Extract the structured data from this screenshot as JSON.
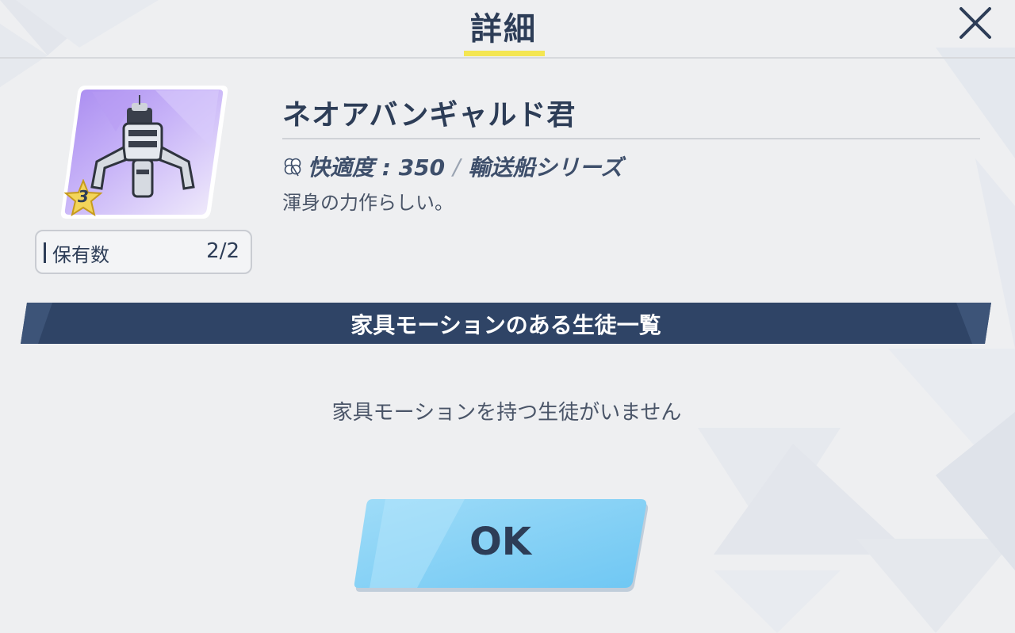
{
  "header": {
    "title": "詳細"
  },
  "item": {
    "name": "ネオアバンギャルド君",
    "rank": "3",
    "owned_label": "保有数",
    "owned_value": "2/2",
    "comfort": "快適度 : 350",
    "series": "輸送船シリーズ",
    "description": "渾身の力作らしい。"
  },
  "section": {
    "title": "家具モーションのある生徒一覧",
    "empty_message": "家具モーションを持つ生徒がいません"
  },
  "actions": {
    "ok_label": "OK"
  },
  "colors": {
    "accent_yellow": "#f4e652",
    "banner_navy": "#2f4466",
    "button_blue": "#86d4f7",
    "text_navy": "#2d3d57"
  }
}
